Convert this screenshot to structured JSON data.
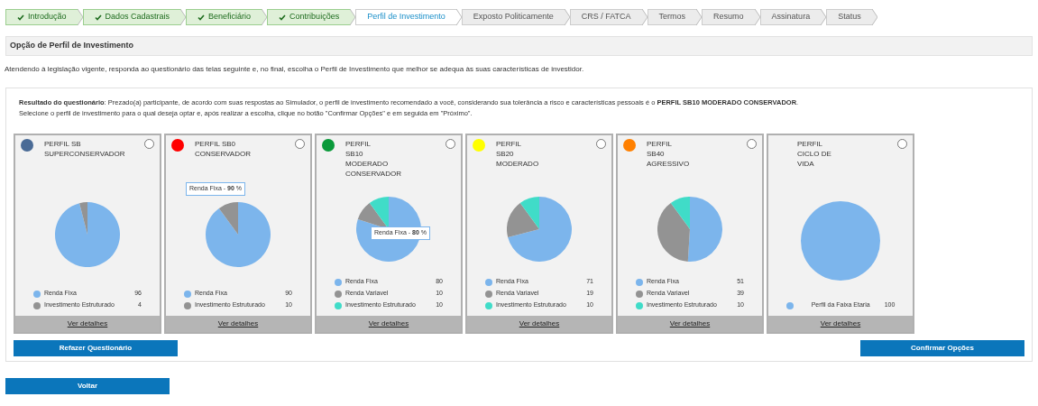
{
  "steps": [
    {
      "label": "Introdução",
      "kind": "done"
    },
    {
      "label": "Dados Cadastrais",
      "kind": "done"
    },
    {
      "label": "Beneficiário",
      "kind": "done"
    },
    {
      "label": "Contribuições",
      "kind": "done"
    },
    {
      "label": "Perfil de Investimento",
      "kind": "current"
    },
    {
      "label": "Exposto Politicamente",
      "kind": "pending"
    },
    {
      "label": "CRS / FATCA",
      "kind": "pending"
    },
    {
      "label": "Termos",
      "kind": "pending"
    },
    {
      "label": "Resumo",
      "kind": "pending"
    },
    {
      "label": "Assinatura",
      "kind": "pending"
    },
    {
      "label": "Status",
      "kind": "pending"
    }
  ],
  "section_title": "Opção de Perfil de Investimento",
  "intro": "Atendendo à legislação vigente, responda ao questionário das telas seguinte e, no final, escolha o Perfil de Investimento que melhor se adequa às suas características de investidor.",
  "result_text": "**Resultado do questionário**: Prezado(a) participante, de acordo com suas respostas ao Simulador, o perfil de investimento recomendado a você, considerando sua tolerância a risco e características pessoais é o **PERFIL SB10 MODERADO CONSERVADOR**.",
  "instruction": "Selecione o perfil de investimento para o qual deseja optar e, após realizar a escolha, clique no botão \"Confirmar Opções\" e em seguida em \"Próximo\".",
  "profiles": [
    {
      "color": "#4a6b96",
      "title": [
        "PERFIL SB",
        "SUPERCONSERVADOR"
      ],
      "selected": false,
      "details": "Ver detalhes",
      "chart_data": {
        "type": "pie",
        "categories": [
          "Renda Fixa",
          "Investimento Estruturado"
        ],
        "values": [
          96,
          4
        ],
        "value_labels": [
          "96",
          "4"
        ],
        "colors": [
          "#7cb5ec",
          "#939393"
        ]
      }
    },
    {
      "color": "#ff0000",
      "title": [
        "PERFIL SB0",
        "CONSERVADOR"
      ],
      "selected": false,
      "details": "Ver detalhes",
      "tooltip": "Renda Fixa - **90** %",
      "chart_data": {
        "type": "pie",
        "categories": [
          "Renda Fixa",
          "Investimento Estruturado"
        ],
        "values": [
          90,
          10
        ],
        "value_labels": [
          "90",
          "10"
        ],
        "colors": [
          "#7cb5ec",
          "#939393"
        ]
      }
    },
    {
      "color": "#0a9a3a",
      "title": [
        "PERFIL",
        "SB10",
        "MODERADO",
        "CONSERVADOR"
      ],
      "selected": false,
      "details": "Ver detalhes",
      "tooltip": "Renda Fixa - **80** %",
      "chart_data": {
        "type": "pie",
        "categories": [
          "Renda Fixa",
          "Renda Variavel",
          "Investimento Estruturado"
        ],
        "values": [
          80,
          10,
          10
        ],
        "value_labels": [
          "80",
          "10",
          "10"
        ],
        "colors": [
          "#7cb5ec",
          "#939393",
          "#40dcc8"
        ]
      }
    },
    {
      "color": "#ffff00",
      "title": [
        "PERFIL",
        "SB20",
        "MODERADO"
      ],
      "selected": false,
      "details": "Ver detalhes",
      "chart_data": {
        "type": "pie",
        "categories": [
          "Renda Fixa",
          "Renda Variavel",
          "Investimento Estruturado"
        ],
        "values": [
          71,
          19,
          10
        ],
        "value_labels": [
          "71",
          "19",
          "10"
        ],
        "colors": [
          "#7cb5ec",
          "#939393",
          "#40dcc8"
        ]
      }
    },
    {
      "color": "#ff8000",
      "title": [
        "PERFIL",
        "SB40",
        "AGRESSIVO"
      ],
      "selected": false,
      "details": "Ver detalhes",
      "chart_data": {
        "type": "pie",
        "categories": [
          "Renda Fixa",
          "Renda Variavel",
          "Investimento Estruturado"
        ],
        "values": [
          51,
          39,
          10
        ],
        "value_labels": [
          "51",
          "39",
          "10"
        ],
        "colors": [
          "#7cb5ec",
          "#939393",
          "#40dcc8"
        ]
      }
    },
    {
      "title": [
        "PERFIL",
        "CICLO DE",
        "VIDA"
      ],
      "selected": false,
      "details": "Ver detalhes",
      "chart_data": {
        "type": "pie",
        "categories": [
          "Perfil da Faixa Etaria"
        ],
        "values": [
          100
        ],
        "value_labels": [
          "100"
        ],
        "colors": [
          "#7cb5ec"
        ]
      }
    }
  ],
  "buttons": {
    "redo": "Refazer Questionário",
    "confirm": "Confirmar Opções",
    "back": "Voltar"
  }
}
